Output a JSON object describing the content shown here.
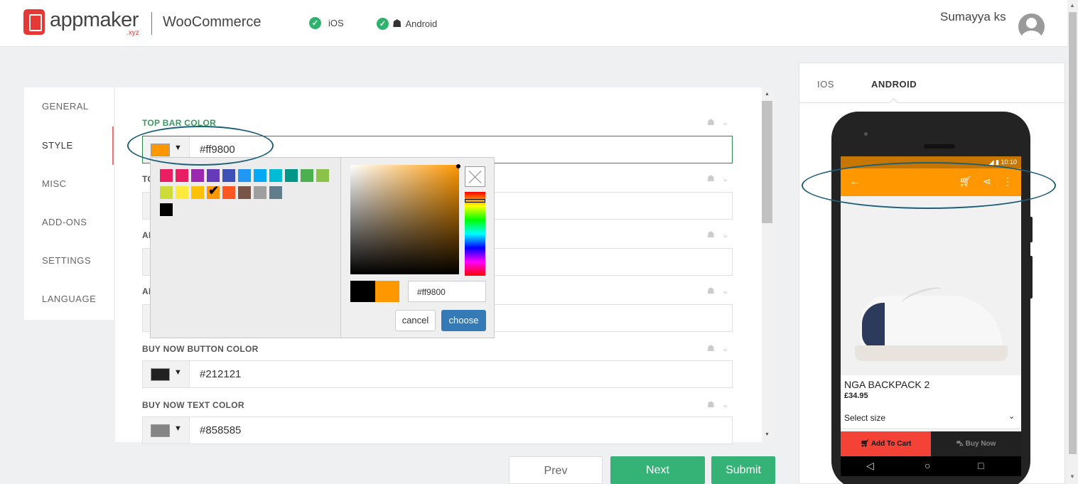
{
  "header": {
    "logo_text": "appmaker",
    "logo_sub": ".xyz",
    "platform_name": "WooCommerce",
    "ios_label": "iOS",
    "android_label": "Android",
    "user_name": "Sumayya ks"
  },
  "sidenav": {
    "items": [
      {
        "label": "GENERAL"
      },
      {
        "label": "STYLE",
        "active": true
      },
      {
        "label": "MISC"
      },
      {
        "label": "ADD-ONS"
      },
      {
        "label": "SETTINGS"
      },
      {
        "label": "LANGUAGE"
      }
    ]
  },
  "fields": [
    {
      "label": "TOP BAR COLOR",
      "value": "#ff9800",
      "swatch": "#ff9800",
      "active": true
    },
    {
      "label": "TO",
      "value": "",
      "swatch": ""
    },
    {
      "label": "AI",
      "value": "",
      "swatch": ""
    },
    {
      "label": "AI",
      "value": "",
      "swatch": ""
    },
    {
      "label": "BUY NOW BUTTON COLOR",
      "value": "#212121",
      "swatch": "#212121"
    },
    {
      "label": "BUY NOW TEXT COLOR",
      "value": "#858585",
      "swatch": "#858585"
    }
  ],
  "picker": {
    "palette": [
      "#e91e63",
      "#e91e63",
      "#9c27b0",
      "#673ab7",
      "#3f51b5",
      "#2196f3",
      "#03a9f4",
      "#00bcd4",
      "#009688",
      "#4caf50",
      "#8bc34a",
      "#cddc39",
      "#ffeb3b",
      "#ffc107",
      "#ff9800",
      "#ff5722",
      "#795548",
      "#9e9e9e",
      "#607d8b",
      "#000000"
    ],
    "selected_color": "#ff9800",
    "previous_color": "#000000",
    "input_value": "#ff9800",
    "cancel_label": "cancel",
    "choose_label": "choose"
  },
  "footer": {
    "prev_label": "Prev",
    "next_label": "Next",
    "submit_label": "Submit"
  },
  "preview": {
    "tabs": [
      "IOS",
      "ANDROID"
    ],
    "active_tab": "ANDROID",
    "status_time": "10:10",
    "product_name": "NGA BACKPACK 2",
    "product_price": "£34.95",
    "select_size": "Select size",
    "add_to_cart": "Add To Cart",
    "buy_now": "Buy Now",
    "top_bar_color": "#ff9800",
    "add_to_cart_color": "#f44336",
    "buy_now_color": "#212121",
    "buy_now_text_color": "#858585"
  },
  "icons": {
    "check": "✔",
    "apple": "",
    "android": "☗",
    "chevron": "⌄",
    "caret": "▼"
  }
}
